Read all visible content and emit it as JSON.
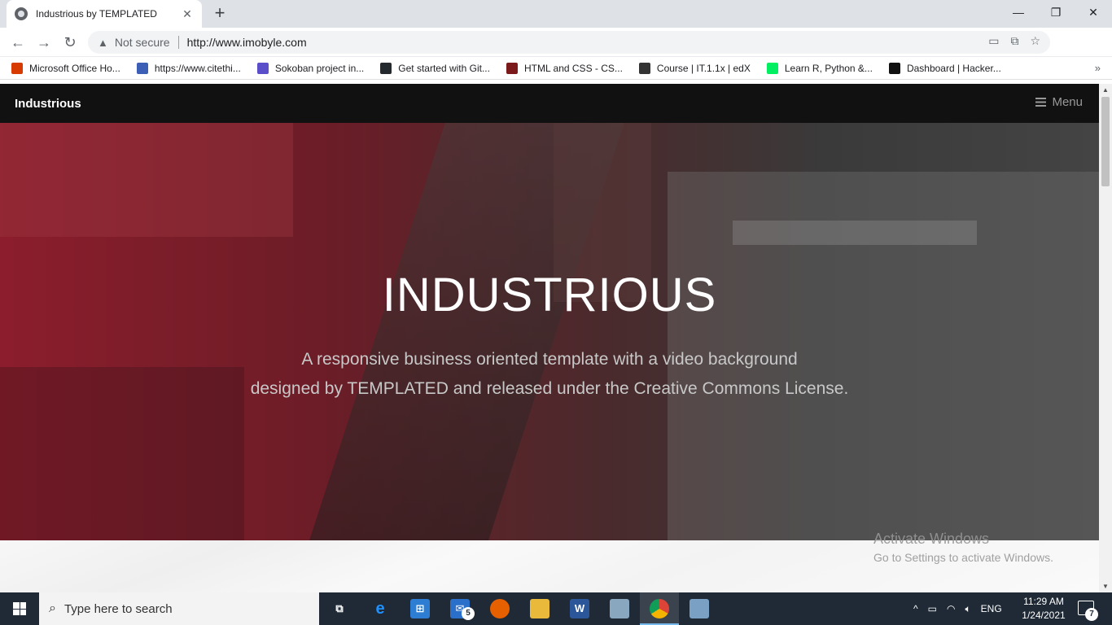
{
  "browser": {
    "tab_title": "Industrious by TEMPLATED",
    "tab_close": "✕",
    "new_tab": "+",
    "minimize": "—",
    "maximize": "❐",
    "close": "✕",
    "security_label": "Not secure",
    "url": "http://www.imobyle.com",
    "bookmarks": [
      {
        "label": "Microsoft Office Ho...",
        "icon": "office-icon",
        "color": "#d83b01"
      },
      {
        "label": "https://www.citethi...",
        "icon": "citethis-icon",
        "color": "#3b5fb4"
      },
      {
        "label": "Sokoban project in...",
        "icon": "chevron-icon",
        "color": "#5b4fc9"
      },
      {
        "label": "Get started with Git...",
        "icon": "github-icon",
        "color": "#24292e"
      },
      {
        "label": "HTML and CSS - CS...",
        "icon": "harvard-icon",
        "color": "#7a1a1a"
      },
      {
        "label": "Course | IT.1.1x | edX",
        "icon": "edx-icon",
        "color": "#333333"
      },
      {
        "label": "Learn R, Python &...",
        "icon": "datacamp-icon",
        "color": "#03ef62"
      },
      {
        "label": "Dashboard | Hacker...",
        "icon": "hackerrank-icon",
        "color": "#111111"
      }
    ],
    "bookmarks_more": "»"
  },
  "site": {
    "logo": "Industrious",
    "menu_label": "Menu",
    "banner_title": "INDUSTRIOUS",
    "banner_subtitle_line1": "A responsive business oriented template with a video background",
    "banner_subtitle_line2": "designed by TEMPLATED and released under the Creative Commons License."
  },
  "watermark": {
    "line1": "Activate Windows",
    "line2": "Go to Settings to activate Windows."
  },
  "taskbar": {
    "search_placeholder": "Type here to search",
    "mail_badge": "5",
    "language": "ENG",
    "time": "11:29 AM",
    "date": "1/24/2021",
    "notification_count": "7"
  }
}
